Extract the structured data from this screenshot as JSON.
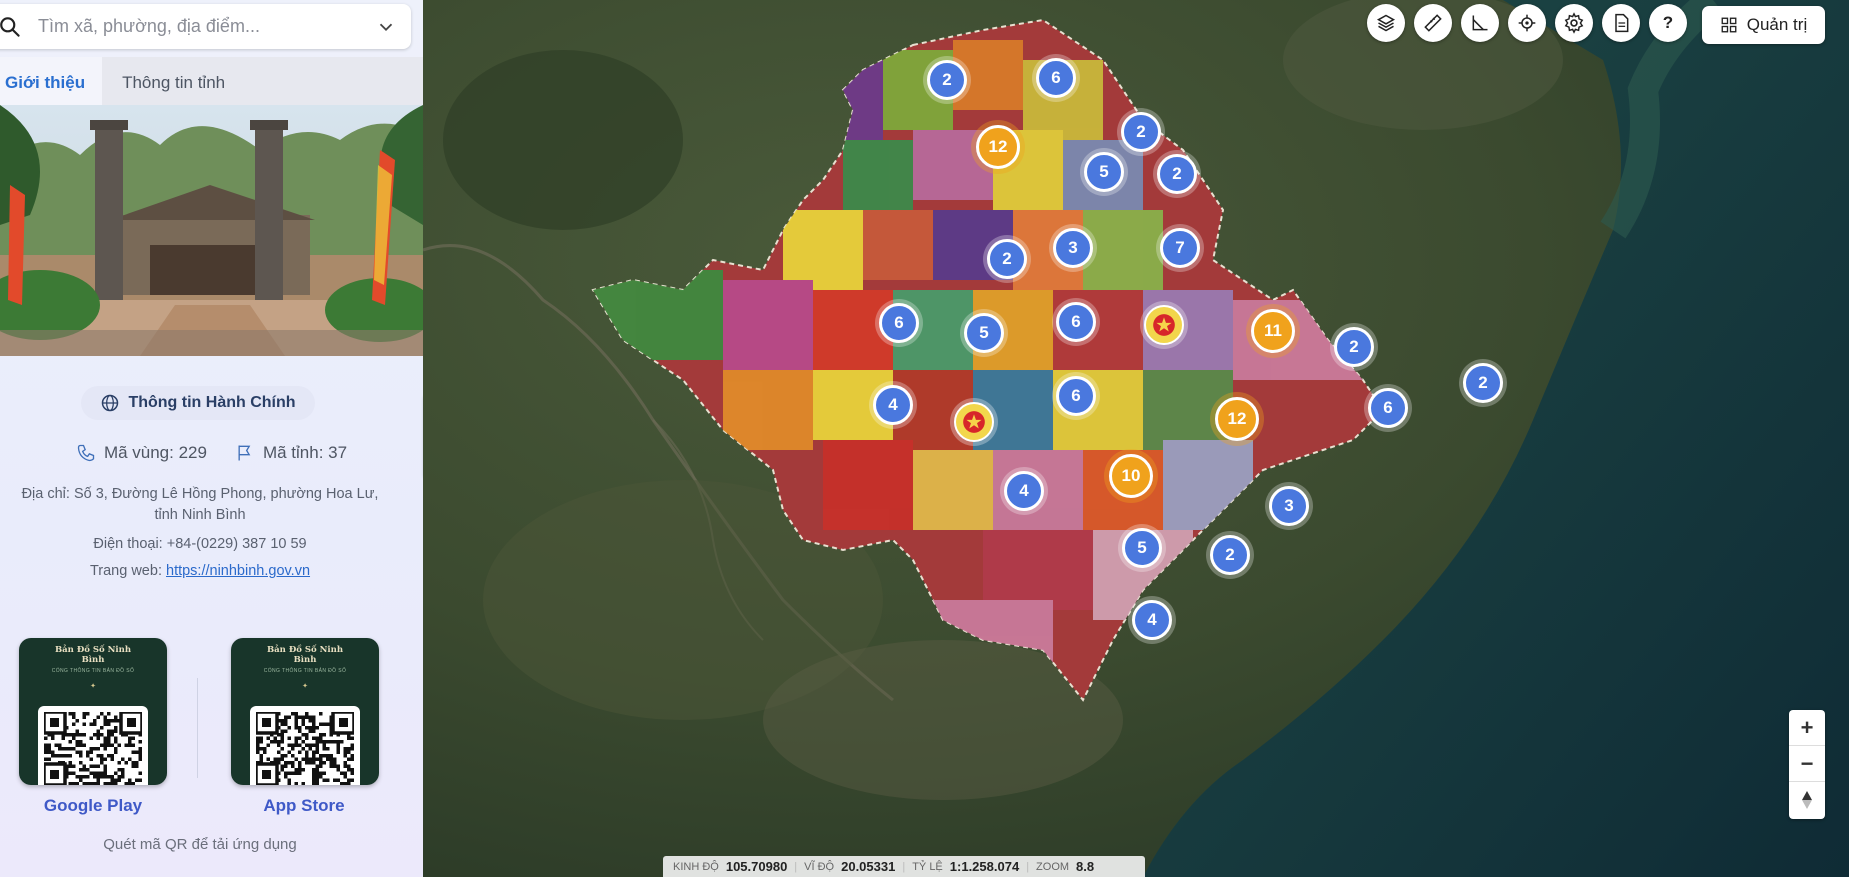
{
  "search": {
    "placeholder": "Tìm xã, phường, địa điểm..."
  },
  "tabs": [
    {
      "label": "Giới thiệu",
      "active": true
    },
    {
      "label": "Thông tin tỉnh",
      "active": false
    }
  ],
  "admin_info_button": "Thông tin Hành Chính",
  "codes": {
    "area_code": "Mã vùng: 229",
    "province_code": "Mã tỉnh: 37"
  },
  "contact": {
    "address": "Địa chỉ: Số 3, Đường Lê Hồng Phong, phường Hoa Lư, tỉnh Ninh Bình",
    "phone": "Điện thoại: +84-(0229) 387 10 59",
    "website_label": "Trang web: ",
    "website_url": "https://ninhbinh.gov.vn"
  },
  "apps": {
    "card_title": "Bản Đồ Số Ninh Bình",
    "card_subtitle": "CỔNG THÔNG TIN BẢN ĐỒ SỐ",
    "google_play": "Google Play",
    "app_store": "App Store",
    "note": "Quét mã QR để tải ứng dụng"
  },
  "toolbar": {
    "icons": [
      "layers-icon",
      "ruler-icon",
      "angle-measure-icon",
      "locate-icon",
      "settings-icon",
      "document-icon",
      "help-icon"
    ],
    "help_label": "?",
    "admin_label": "Quản trị"
  },
  "map_clusters": [
    {
      "count": "2",
      "color": "blue"
    },
    {
      "count": "6",
      "color": "blue"
    },
    {
      "count": "12",
      "color": "orange"
    },
    {
      "count": "2",
      "color": "blue"
    },
    {
      "count": "5",
      "color": "blue"
    },
    {
      "count": "2",
      "color": "blue"
    },
    {
      "count": "3",
      "color": "blue"
    },
    {
      "count": "7",
      "color": "blue"
    },
    {
      "count": "2",
      "color": "blue"
    },
    {
      "count": "6",
      "color": "blue"
    },
    {
      "count": "5",
      "color": "blue"
    },
    {
      "count": "6",
      "color": "blue"
    },
    {
      "count": "11",
      "color": "orange"
    },
    {
      "count": "2",
      "color": "blue"
    },
    {
      "count": "2",
      "color": "blue"
    },
    {
      "count": "4",
      "color": "blue"
    },
    {
      "count": "6",
      "color": "blue"
    },
    {
      "count": "12",
      "color": "orange"
    },
    {
      "count": "6",
      "color": "blue"
    },
    {
      "count": "4",
      "color": "blue"
    },
    {
      "count": "10",
      "color": "orange"
    },
    {
      "count": "3",
      "color": "blue"
    },
    {
      "count": "5",
      "color": "blue"
    },
    {
      "count": "2",
      "color": "blue"
    },
    {
      "count": "4",
      "color": "blue"
    }
  ],
  "status": {
    "lon_label": "KINH ĐỘ",
    "lon": "105.70980",
    "lat_label": "VĨ ĐỘ",
    "lat": "20.05331",
    "scale_label": "TỶ LỆ",
    "scale": "1:1.258.074",
    "zoom_label": "ZOOM",
    "zoom": "8.8"
  },
  "colors": {
    "accent": "#2a6fd0",
    "cluster_blue": "#4a78de",
    "cluster_orange": "#f0a21c"
  }
}
